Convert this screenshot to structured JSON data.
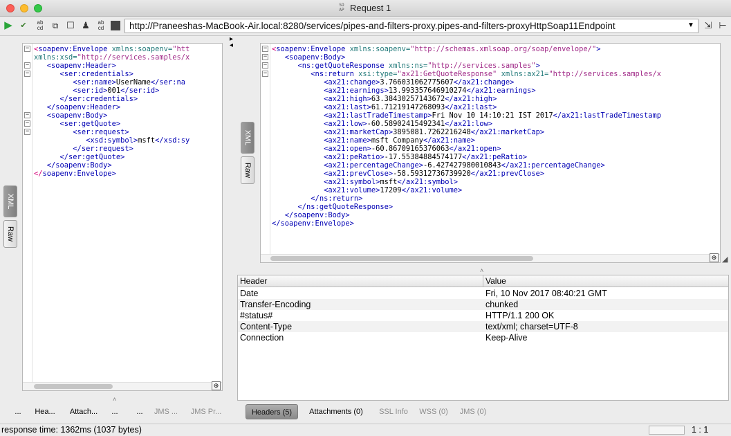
{
  "window": {
    "title": "Request 1",
    "title_icon_text": "SO AP"
  },
  "toolbar": {
    "url": "http://Praneeshas-MacBook-Air.local:8280/services/pipes-and-filters-proxy.pipes-and-filters-proxyHttpSoap11Endpoint",
    "icons": [
      "play-icon",
      "validate-icon",
      "format-icon",
      "stop-icon",
      "checkbox-icon",
      "user-icon",
      "soap-icon",
      "square-icon",
      "dropdown-icon",
      "settings-icon",
      "expand-icon"
    ]
  },
  "request": {
    "tabs": {
      "xml": "XML",
      "raw": "Raw"
    },
    "lines": [
      {
        "fold": "minus",
        "parts": [
          [
            "p",
            "<"
          ],
          [
            "t",
            "soapenv:Envelope"
          ],
          [
            "a",
            " xmlns:soapenv="
          ],
          [
            "v",
            "\"htt"
          ]
        ]
      },
      {
        "fold": "",
        "parts": [
          [
            "a",
            "xmlns:xsd="
          ],
          [
            "v",
            "\"http://services.samples/x"
          ]
        ]
      },
      {
        "fold": "minus",
        "parts": [
          [
            "t",
            "   <soapenv:Header>"
          ]
        ]
      },
      {
        "fold": "minus",
        "parts": [
          [
            "t",
            "      <ser:credentials>"
          ]
        ]
      },
      {
        "fold": "",
        "parts": [
          [
            "t",
            "         <ser:name>"
          ],
          [
            "x",
            "UserName"
          ],
          [
            "t",
            "</ser:na"
          ]
        ]
      },
      {
        "fold": "",
        "parts": [
          [
            "t",
            "         <ser:id>"
          ],
          [
            "x",
            "001"
          ],
          [
            "t",
            "</ser:id>"
          ]
        ]
      },
      {
        "fold": "",
        "parts": [
          [
            "t",
            "      </ser:credentials>"
          ]
        ]
      },
      {
        "fold": "",
        "parts": [
          [
            "t",
            "   </soapenv:Header>"
          ]
        ]
      },
      {
        "fold": "minus",
        "parts": [
          [
            "t",
            "   <soapenv:Body>"
          ]
        ]
      },
      {
        "fold": "minus",
        "parts": [
          [
            "t",
            "      <ser:getQuote>"
          ]
        ]
      },
      {
        "fold": "minus",
        "parts": [
          [
            "t",
            "         <ser:request>"
          ]
        ]
      },
      {
        "fold": "",
        "parts": [
          [
            "t",
            "            <xsd:symbol>"
          ],
          [
            "x",
            "msft"
          ],
          [
            "t",
            "</xsd:sy"
          ]
        ]
      },
      {
        "fold": "",
        "parts": [
          [
            "t",
            "         </ser:request>"
          ]
        ]
      },
      {
        "fold": "",
        "parts": [
          [
            "t",
            "      </ser:getQuote>"
          ]
        ]
      },
      {
        "fold": "",
        "parts": [
          [
            "t",
            "   </soapenv:Body>"
          ]
        ]
      },
      {
        "fold": "",
        "parts": [
          [
            "p",
            "</"
          ],
          [
            "t",
            "soapenv:Envelope>"
          ]
        ]
      }
    ]
  },
  "response": {
    "tabs": {
      "xml": "XML",
      "raw": "Raw"
    },
    "lines": [
      {
        "fold": "minus",
        "parts": [
          [
            "p",
            "<"
          ],
          [
            "t",
            "soapenv:Envelope"
          ],
          [
            "a",
            " xmlns:soapenv="
          ],
          [
            "v",
            "\"http://schemas.xmlsoap.org/soap/envelope/\""
          ],
          [
            "t",
            ">"
          ]
        ]
      },
      {
        "fold": "minus",
        "parts": [
          [
            "t",
            "   <soapenv:Body>"
          ]
        ]
      },
      {
        "fold": "minus",
        "parts": [
          [
            "t",
            "      <ns:getQuoteResponse"
          ],
          [
            "a",
            " xmlns:ns="
          ],
          [
            "v",
            "\"http://services.samples\""
          ],
          [
            "t",
            ">"
          ]
        ]
      },
      {
        "fold": "minus",
        "parts": [
          [
            "t",
            "         <ns:return"
          ],
          [
            "a",
            " xsi:type="
          ],
          [
            "v",
            "\"ax21:GetQuoteResponse\""
          ],
          [
            "a",
            " xmlns:ax21="
          ],
          [
            "v",
            "\"http://services.samples/x"
          ]
        ]
      },
      {
        "fold": "",
        "parts": [
          [
            "t",
            "            <ax21:change>"
          ],
          [
            "x",
            "3.766031062775607"
          ],
          [
            "t",
            "</ax21:change>"
          ]
        ]
      },
      {
        "fold": "",
        "parts": [
          [
            "t",
            "            <ax21:earnings>"
          ],
          [
            "x",
            "13.993357646910274"
          ],
          [
            "t",
            "</ax21:earnings>"
          ]
        ]
      },
      {
        "fold": "",
        "parts": [
          [
            "t",
            "            <ax21:high>"
          ],
          [
            "x",
            "63.38430257143672"
          ],
          [
            "t",
            "</ax21:high>"
          ]
        ]
      },
      {
        "fold": "",
        "parts": [
          [
            "t",
            "            <ax21:last>"
          ],
          [
            "x",
            "61.71219147268093"
          ],
          [
            "t",
            "</ax21:last>"
          ]
        ]
      },
      {
        "fold": "",
        "parts": [
          [
            "t",
            "            <ax21:lastTradeTimestamp>"
          ],
          [
            "x",
            "Fri Nov 10 14:10:21 IST 2017"
          ],
          [
            "t",
            "</ax21:lastTradeTimestamp"
          ]
        ]
      },
      {
        "fold": "",
        "parts": [
          [
            "t",
            "            <ax21:low>"
          ],
          [
            "x",
            "-60.58902415492341"
          ],
          [
            "t",
            "</ax21:low>"
          ]
        ]
      },
      {
        "fold": "",
        "parts": [
          [
            "t",
            "            <ax21:marketCap>"
          ],
          [
            "x",
            "3895081.7262216248"
          ],
          [
            "t",
            "</ax21:marketCap>"
          ]
        ]
      },
      {
        "fold": "",
        "parts": [
          [
            "t",
            "            <ax21:name>"
          ],
          [
            "x",
            "msft Company"
          ],
          [
            "t",
            "</ax21:name>"
          ]
        ]
      },
      {
        "fold": "",
        "parts": [
          [
            "t",
            "            <ax21:open>"
          ],
          [
            "x",
            "-60.86709165376063"
          ],
          [
            "t",
            "</ax21:open>"
          ]
        ]
      },
      {
        "fold": "",
        "parts": [
          [
            "t",
            "            <ax21:peRatio>"
          ],
          [
            "x",
            "-17.55384884574177"
          ],
          [
            "t",
            "</ax21:peRatio>"
          ]
        ]
      },
      {
        "fold": "",
        "parts": [
          [
            "t",
            "            <ax21:percentageChange>"
          ],
          [
            "x",
            "-6.427427980010843"
          ],
          [
            "t",
            "</ax21:percentageChange>"
          ]
        ]
      },
      {
        "fold": "",
        "parts": [
          [
            "t",
            "            <ax21:prevClose>"
          ],
          [
            "x",
            "-58.59312736739920"
          ],
          [
            "t",
            "</ax21:prevClose>"
          ]
        ]
      },
      {
        "fold": "",
        "parts": [
          [
            "t",
            "            <ax21:symbol>"
          ],
          [
            "x",
            "msft"
          ],
          [
            "t",
            "</ax21:symbol>"
          ]
        ]
      },
      {
        "fold": "",
        "parts": [
          [
            "t",
            "            <ax21:volume>"
          ],
          [
            "x",
            "17209"
          ],
          [
            "t",
            "</ax21:volume>"
          ]
        ]
      },
      {
        "fold": "",
        "parts": [
          [
            "t",
            "         </ns:return>"
          ]
        ]
      },
      {
        "fold": "",
        "parts": [
          [
            "t",
            "      </ns:getQuoteResponse>"
          ]
        ]
      },
      {
        "fold": "",
        "parts": [
          [
            "t",
            "   </soapenv:Body>"
          ]
        ]
      },
      {
        "fold": "",
        "parts": [
          [
            "t",
            "</soapenv:Envelope>"
          ]
        ]
      }
    ]
  },
  "headers_table": {
    "columns": [
      "Header",
      "Value"
    ],
    "rows": [
      [
        "Date",
        "Fri, 10 Nov 2017 08:40:21 GMT"
      ],
      [
        "Transfer-Encoding",
        "chunked"
      ],
      [
        "#status#",
        "HTTP/1.1 200 OK"
      ],
      [
        "Content-Type",
        "text/xml; charset=UTF-8"
      ],
      [
        "Connection",
        "Keep-Alive"
      ]
    ]
  },
  "request_bottom_tabs": [
    "...",
    "Hea...",
    "Attach...",
    "...",
    "...",
    "JMS ...",
    "JMS Pr..."
  ],
  "response_bottom_tabs": [
    "Headers (5)",
    "Attachments (0)",
    "SSL Info",
    "WSS (0)",
    "JMS (0)"
  ],
  "status": {
    "response_time": "response time: 1362ms (1037 bytes)",
    "position": "1 : 1"
  }
}
